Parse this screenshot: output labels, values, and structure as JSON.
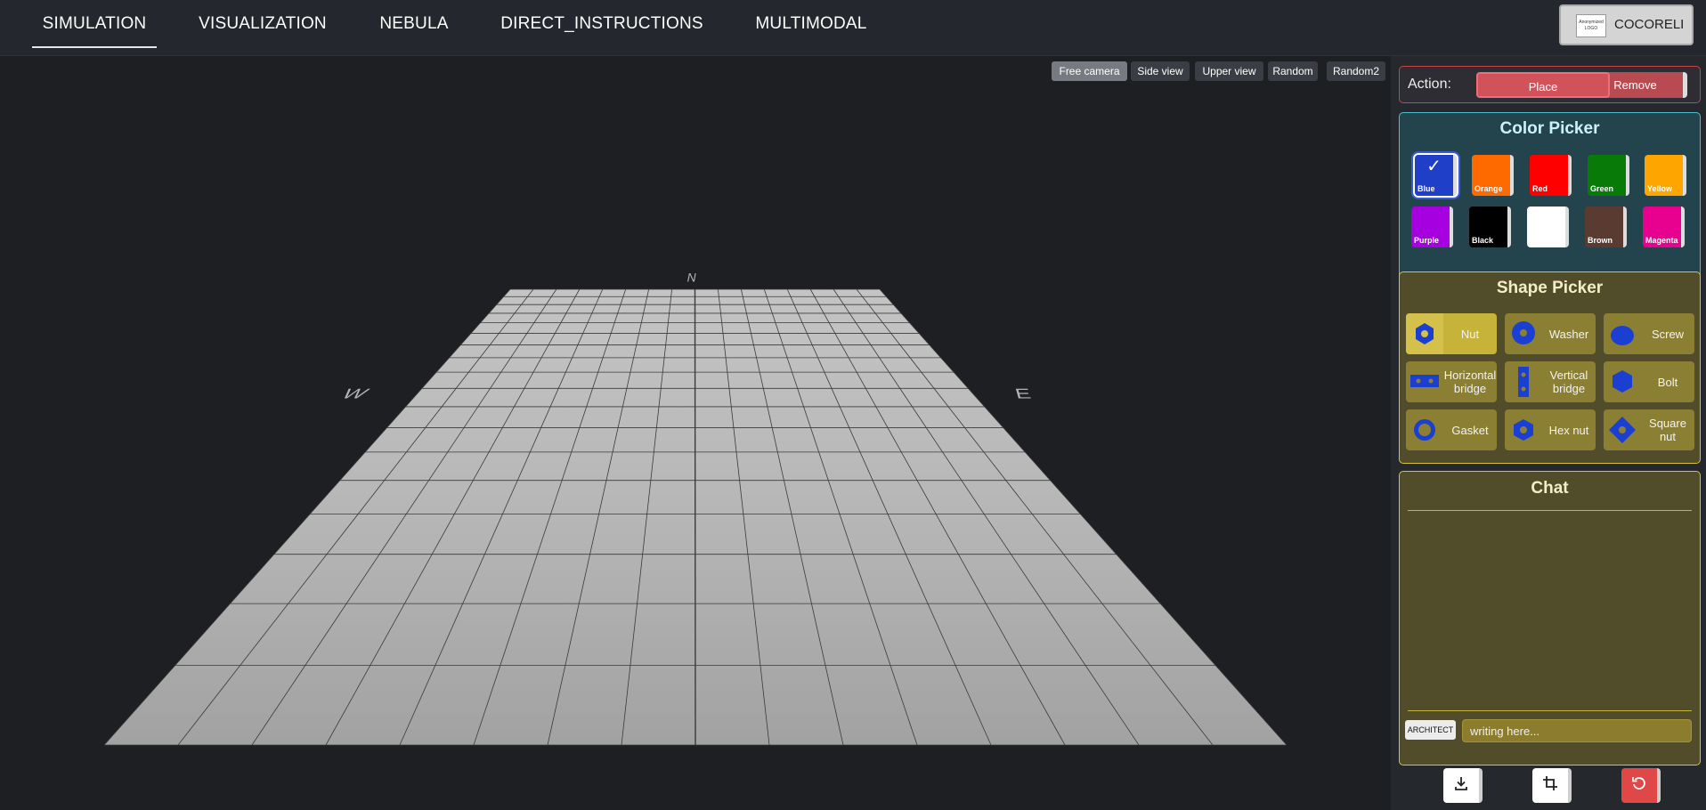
{
  "nav": {
    "tabs": [
      {
        "label": "SIMULATION"
      },
      {
        "label": "VISUALIZATION"
      },
      {
        "label": "NEBULA"
      },
      {
        "label": "DIRECT_INSTRUCTIONS"
      },
      {
        "label": "MULTIMODAL"
      }
    ],
    "active_tab": "SIMULATION",
    "brand": {
      "logo_text": "Anonymized LOGO",
      "name": "COCORELI"
    }
  },
  "viewport": {
    "camera_buttons": [
      {
        "label": "Free camera"
      },
      {
        "label": "Side view"
      },
      {
        "label": "Upper view"
      },
      {
        "label": "Random"
      },
      {
        "label": "Random2"
      }
    ],
    "active_camera": "Free camera",
    "compass": {
      "north": "N",
      "west": "W",
      "east": "E"
    }
  },
  "action": {
    "label": "Action:",
    "place_label": "Place",
    "remove_label": "Remove",
    "selected": "Place"
  },
  "color_picker": {
    "title": "Color Picker",
    "colors": [
      {
        "name": "Blue",
        "hex": "#1f3fc9"
      },
      {
        "name": "Orange",
        "hex": "#ff6a00"
      },
      {
        "name": "Red",
        "hex": "#ff0000"
      },
      {
        "name": "Green",
        "hex": "#077a07"
      },
      {
        "name": "Yellow",
        "hex": "#ffa500"
      },
      {
        "name": "Purple",
        "hex": "#a600e0"
      },
      {
        "name": "Black",
        "hex": "#000000"
      },
      {
        "name": "White",
        "hex": "#ffffff"
      },
      {
        "name": "Brown",
        "hex": "#5a3b31"
      },
      {
        "name": "Magenta",
        "hex": "#e8008e"
      }
    ],
    "selected": "Blue"
  },
  "shape_picker": {
    "title": "Shape Picker",
    "shapes": [
      {
        "name": "Nut",
        "icon": "nut-icon"
      },
      {
        "name": "Washer",
        "icon": "washer-icon"
      },
      {
        "name": "Screw",
        "icon": "screw-icon"
      },
      {
        "name": "Horizontal bridge",
        "icon": "horizontal-bridge-icon"
      },
      {
        "name": "Vertical bridge",
        "icon": "vertical-bridge-icon"
      },
      {
        "name": "Bolt",
        "icon": "bolt-icon"
      },
      {
        "name": "Gasket",
        "icon": "gasket-icon"
      },
      {
        "name": "Hex nut",
        "icon": "hex-nut-icon"
      },
      {
        "name": "Square nut",
        "icon": "square-nut-icon"
      }
    ],
    "selected": "Nut"
  },
  "chat": {
    "title": "Chat",
    "role_label": "ARCHITECT",
    "input_placeholder": "writing here..."
  },
  "toolbar": {
    "buttons": [
      {
        "icon": "download-icon"
      },
      {
        "icon": "crop-icon"
      },
      {
        "icon": "reset-icon"
      }
    ]
  },
  "colors": {
    "accent_red": "#d1525a",
    "accent_teal": "#4cc1cc",
    "accent_gold": "#d7c23a"
  }
}
